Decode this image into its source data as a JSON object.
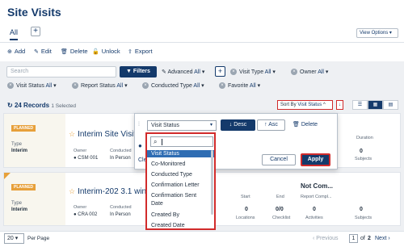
{
  "header": {
    "title": "Site Visits",
    "tab_all": "All",
    "add_tab": "+",
    "view_options": "View Options"
  },
  "toolbar": {
    "add": "Add",
    "edit": "Edit",
    "delete": "Delete",
    "unlock": "Unlock",
    "export": "Export"
  },
  "filters": {
    "search_placeholder": "Search",
    "filters_button": "Filters",
    "advanced_label": "Advanced",
    "advanced_value": "All",
    "visit_type_label": "Visit Type",
    "visit_type_value": "All",
    "owner_label": "Owner",
    "owner_value": "All",
    "visit_status_label": "Visit Status",
    "visit_status_value": "All",
    "report_status_label": "Report Status",
    "report_status_value": "All",
    "conducted_type_label": "Conducted Type",
    "conducted_type_value": "All",
    "favorite_label": "Favorite",
    "favorite_value": "All"
  },
  "summary": {
    "records": "24 Records",
    "selected": "1 Selected",
    "sort_by_label": "Sort By",
    "sort_by_value": "Visit Status"
  },
  "sort_panel": {
    "field_value": "Visit Status",
    "desc": "Desc",
    "asc": "Asc",
    "delete": "Delete",
    "clear": "Cle",
    "cancel": "Cancel",
    "apply": "Apply",
    "options": [
      "Visit Status",
      "Co-Monitored",
      "Conducted Type",
      "Confirmation Letter",
      "Confirmation Sent",
      "Date",
      "Created By",
      "Created Date"
    ]
  },
  "cards": [
    {
      "status": "PLANNED",
      "type_label": "Type",
      "type_value": "Interim",
      "title": "Interim Site Visit",
      "owner_label": "Owner",
      "owner_value": "CSM 001",
      "conducted_label": "Conducted",
      "conducted_value": "In Person",
      "duration_label": "Duration",
      "subjects_value": "0",
      "subjects_label": "Subjects"
    },
    {
      "status": "PLANNED",
      "type_label": "Type",
      "type_value": "Interim",
      "title": "Interim-202 3.1 wind",
      "owner_label": "Owner",
      "owner_value": "CRA 002",
      "conducted_label": "Conducted",
      "conducted_value": "In Person",
      "start_label": "Start",
      "end_label": "End",
      "report_text": "Not Com...",
      "report_label": "Report Compl...",
      "locations_value": "0",
      "locations_label": "Locations",
      "checklist_value": "0/0",
      "checklist_label": "Checklist",
      "activities_value": "0",
      "activities_label": "Activities",
      "subjects_value": "0",
      "subjects_label": "Subjects"
    }
  ],
  "pagination": {
    "per_page_value": "20",
    "per_page_label": "Per Page",
    "previous": "Previous",
    "page": "1",
    "of_label": "of",
    "total": "2",
    "next": "Next"
  }
}
